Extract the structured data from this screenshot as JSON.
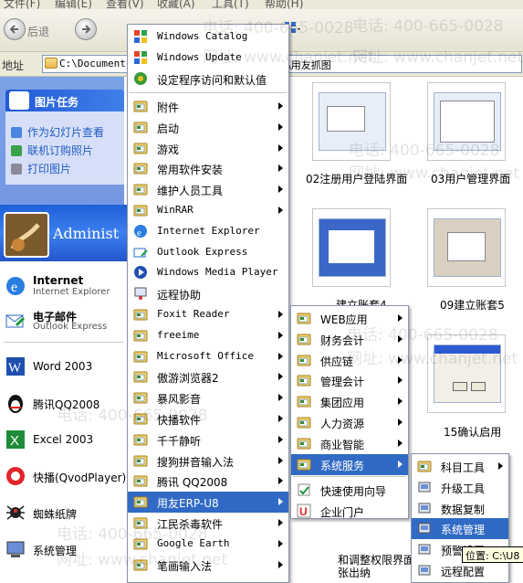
{
  "menubar": {
    "items": [
      "文件(F)",
      "编辑(E)",
      "查看(V)",
      "收藏(A)",
      "工具(T)",
      "帮助(H)"
    ]
  },
  "toolbar": {
    "back_label": "后退",
    "icons": [
      "back-arrow-icon",
      "forward-arrow-icon",
      "up-folder-icon",
      "views-icon"
    ]
  },
  "address": {
    "label": "地址",
    "value": "C:\\Documents",
    "value_tail": "桌面\\用友抓图"
  },
  "taskpane": {
    "title": "图片任务",
    "items": [
      "作为幻灯片查看",
      "联机订购照片",
      "打印图片"
    ]
  },
  "startmenu": {
    "user": "Administ",
    "pinned": [
      {
        "title": "Internet",
        "subtitle": "Internet Explorer",
        "icon": "internet-explorer-icon"
      },
      {
        "title": "电子邮件",
        "subtitle": "Outlook Express",
        "icon": "outlook-express-icon"
      }
    ],
    "recent": [
      {
        "title": "Word 2003",
        "icon": "word-icon"
      },
      {
        "title": "腾讯QQ2008",
        "icon": "qq-penguin-icon"
      },
      {
        "title": "Excel 2003",
        "icon": "excel-icon"
      },
      {
        "title": "快播(QvodPlayer)",
        "icon": "qvod-player-icon"
      },
      {
        "title": "蜘蛛纸牌",
        "icon": "spider-solitaire-icon"
      },
      {
        "title": "系统管理",
        "icon": "system-admin-icon"
      }
    ]
  },
  "programs_menu": {
    "top": [
      {
        "label": "Windows Catalog",
        "icon": "windows-catalog-icon"
      },
      {
        "label": "Windows Update",
        "icon": "windows-update-icon"
      },
      {
        "label": "设定程序访问和默认值",
        "icon": "program-access-icon"
      }
    ],
    "items": [
      {
        "label": "附件",
        "submenu": true,
        "type": "folder"
      },
      {
        "label": "启动",
        "submenu": true,
        "type": "folder"
      },
      {
        "label": "游戏",
        "submenu": true,
        "type": "folder"
      },
      {
        "label": "常用软件安装",
        "submenu": true,
        "type": "folder"
      },
      {
        "label": "维护人员工具",
        "submenu": true,
        "type": "folder"
      },
      {
        "label": "WinRAR",
        "submenu": true,
        "type": "folder"
      },
      {
        "label": "Internet Explorer",
        "submenu": false,
        "type": "ie"
      },
      {
        "label": "Outlook Express",
        "submenu": false,
        "type": "outlook"
      },
      {
        "label": "Windows Media Player",
        "submenu": false,
        "type": "wmp"
      },
      {
        "label": "远程协助",
        "submenu": false,
        "type": "remote"
      },
      {
        "label": "Foxit Reader",
        "submenu": true,
        "type": "folder"
      },
      {
        "label": "freeime",
        "submenu": true,
        "type": "folder"
      },
      {
        "label": "Microsoft Office",
        "submenu": true,
        "type": "folder"
      },
      {
        "label": "傲游浏览器2",
        "submenu": true,
        "type": "folder"
      },
      {
        "label": "暴风影音",
        "submenu": true,
        "type": "folder"
      },
      {
        "label": "快播软件",
        "submenu": true,
        "type": "folder"
      },
      {
        "label": "千千静听",
        "submenu": true,
        "type": "folder"
      },
      {
        "label": "搜狗拼音输入法",
        "submenu": true,
        "type": "folder"
      },
      {
        "label": "腾讯 QQ2008",
        "submenu": true,
        "type": "folder"
      },
      {
        "label": "用友ERP-U8",
        "submenu": true,
        "type": "folder",
        "highlight": true
      },
      {
        "label": "江民杀毒软件",
        "submenu": true,
        "type": "folder"
      },
      {
        "label": "Google Earth",
        "submenu": true,
        "type": "folder"
      },
      {
        "label": "笔画输入法",
        "submenu": true,
        "type": "folder"
      }
    ]
  },
  "u8_menu": {
    "items": [
      {
        "label": "WEB应用",
        "submenu": true
      },
      {
        "label": "财务会计",
        "submenu": true
      },
      {
        "label": "供应链",
        "submenu": true
      },
      {
        "label": "管理会计",
        "submenu": true
      },
      {
        "label": "集团应用",
        "submenu": true
      },
      {
        "label": "人力资源",
        "submenu": true
      },
      {
        "label": "商业智能",
        "submenu": true
      },
      {
        "label": "系统服务",
        "submenu": true,
        "highlight": true
      }
    ],
    "bottom": [
      {
        "label": "快速使用向导",
        "icon": "quick-guide-icon"
      },
      {
        "label": "企业门户",
        "icon": "enterprise-portal-icon"
      }
    ]
  },
  "sys_menu": {
    "items": [
      {
        "label": "科目工具",
        "submenu": true,
        "icon": "folder-icon"
      },
      {
        "label": "升级工具",
        "submenu": false,
        "icon": "upgrade-tool-icon"
      },
      {
        "label": "数据复制",
        "submenu": false,
        "icon": "data-copy-icon"
      },
      {
        "label": "系统管理",
        "submenu": false,
        "icon": "system-admin-icon",
        "highlight": true
      },
      {
        "label": "预警设置",
        "submenu": false,
        "icon": "alert-setting-icon"
      },
      {
        "label": "远程配置",
        "submenu": false,
        "icon": "remote-config-icon"
      }
    ]
  },
  "thumbnails": [
    {
      "label": "02注册用户登陆界面"
    },
    {
      "label": "03用户管理界面"
    },
    {
      "label": "建立账套4"
    },
    {
      "label": "09建立账套5"
    },
    {
      "label": "15确认启用"
    },
    {
      "label": "和调整权限界面"
    },
    {
      "label": "张出纳"
    }
  ],
  "tooltip": {
    "text": "位置: C:\\U8"
  },
  "watermarks": [
    "电话: 400-665-0028",
    "网址: www.chanjet.net"
  ],
  "colors": {
    "highlight": "#316ac5",
    "taskpane": "#6375d6",
    "header": "#225ad6"
  }
}
